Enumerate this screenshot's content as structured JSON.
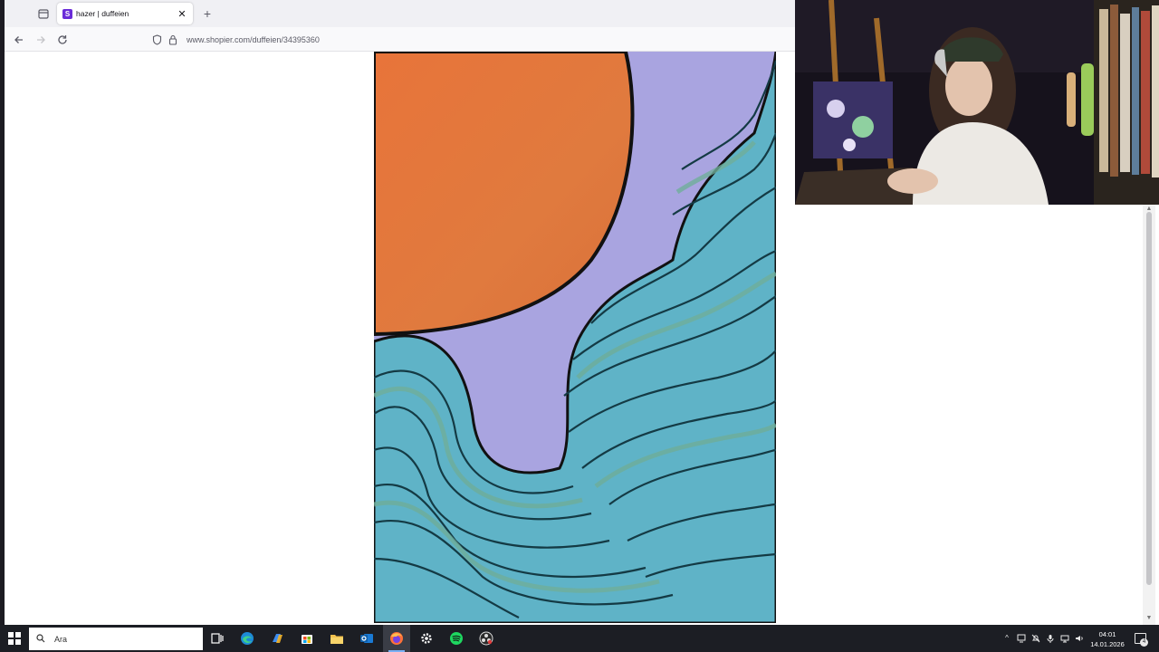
{
  "browser": {
    "tab": {
      "title": "hazer | duffeien",
      "favicon_letter": "S"
    },
    "url": "www.shopier.com/duffeien/34395360"
  },
  "taskbar": {
    "search_text": "Ara",
    "clock_time": "04:01",
    "clock_date": "14.01.2026",
    "notification_count": "4"
  },
  "colors": {
    "accent": "#6a2bd8",
    "sun": "#e57a3c",
    "sky": "#a9a4e0",
    "wave_teal": "#5fb3c7",
    "wave_green": "#6fae9a"
  },
  "icons": [
    "tab-list-icon",
    "close-icon",
    "plus-icon",
    "back-arrow-icon",
    "forward-arrow-icon",
    "reload-icon",
    "tracking-shield-icon",
    "lock-icon",
    "windows-start-icon",
    "search-icon",
    "task-view-icon",
    "edge-icon",
    "copilot-icon",
    "store-icon",
    "file-explorer-icon",
    "outlook-icon",
    "firefox-icon",
    "settings-gear-icon",
    "spotify-icon",
    "obs-icon"
  ]
}
